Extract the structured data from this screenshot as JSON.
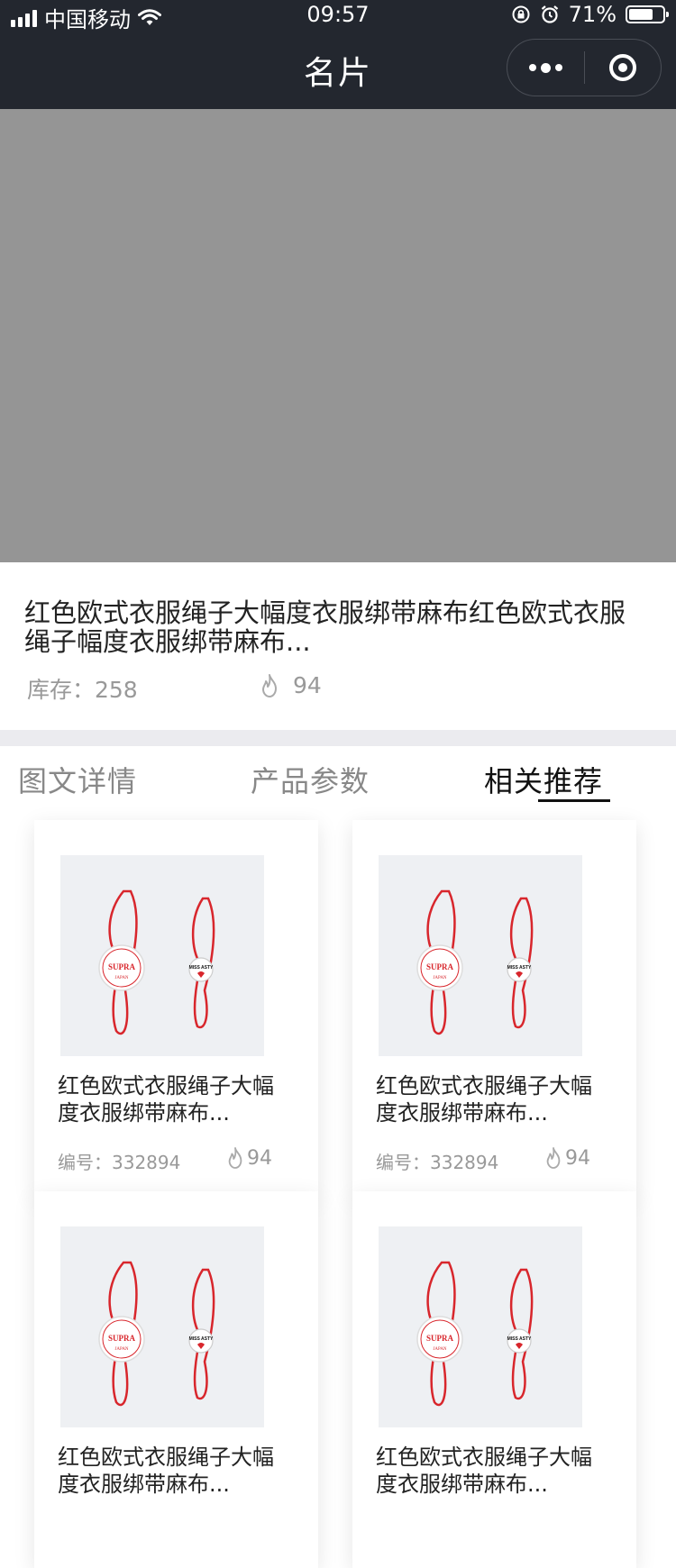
{
  "status_bar": {
    "carrier": "中国移动",
    "time": "09:57",
    "battery_percent": "71%",
    "battery_level": 0.71
  },
  "nav": {
    "title": "名片"
  },
  "product": {
    "title": "红色欧式衣服绳子大幅度衣服绑带麻布红色欧式衣服绳子幅度衣服绑带麻布...",
    "stock_label": "库存：258",
    "heat_count": "94"
  },
  "tabs": [
    {
      "label": "图文详情"
    },
    {
      "label": "产品参数"
    },
    {
      "label": "相关推荐"
    }
  ],
  "active_tab_index": 2,
  "recommend": [
    {
      "title": "红色欧式衣服绳子大幅度衣服绑带麻布...",
      "code": "编号：332894",
      "heat": "94",
      "badge1": "SUPRA",
      "badge1_sub": "JAPAN",
      "badge2": "MISS ASTY"
    },
    {
      "title": "红色欧式衣服绳子大幅度衣服绑带麻布...",
      "code": "编号：332894",
      "heat": "94",
      "badge1": "SUPRA",
      "badge1_sub": "JAPAN",
      "badge2": "MISS ASTY"
    },
    {
      "title": "红色欧式衣服绳子大幅度衣服绑带麻布...",
      "code": "",
      "heat": "",
      "badge1": "SUPRA",
      "badge1_sub": "JAPAN",
      "badge2": "MISS ASTY"
    },
    {
      "title": "红色欧式衣服绳子大幅度衣服绑带麻布...",
      "code": "",
      "heat": "",
      "badge1": "SUPRA",
      "badge1_sub": "JAPAN",
      "badge2": "MISS ASTY"
    }
  ],
  "colors": {
    "nav_bg": "#23272f",
    "hero_bg": "#959595",
    "section_gap": "#ebebef",
    "tag_red": "#d8262c"
  }
}
